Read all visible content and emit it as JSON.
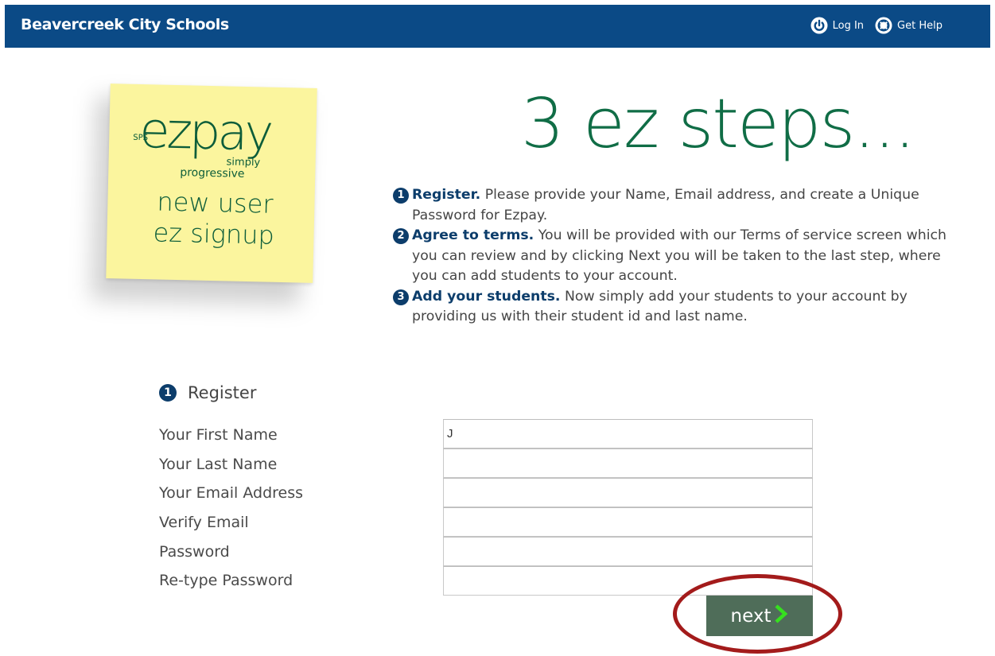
{
  "header": {
    "brand": "Beavercreek City Schools",
    "login_label": "Log In",
    "help_label": "Get Help"
  },
  "sticky_note": {
    "logo_sps": "SPS",
    "logo_main": "ezpay",
    "logo_simply": "simply",
    "logo_progressive": "progressive",
    "line1": "new user",
    "line2": "ez signup",
    "color": "#fbf59e"
  },
  "headline": "3 ez steps...",
  "steps": [
    {
      "number": "1",
      "title": "Register.",
      "text": " Please provide your Name, Email address, and create a Unique Password for Ezpay."
    },
    {
      "number": "2",
      "title": "Agree to terms.",
      "text": " You will be provided with our Terms of service screen which you can review and by clicking Next you will be taken to the last step, where you can add students to your account."
    },
    {
      "number": "3",
      "title": "Add your students.",
      "text": " Now simply add your students to your account by providing us with their student id and last name."
    }
  ],
  "register": {
    "number": "1",
    "heading": "Register",
    "fields": [
      {
        "label": "Your First Name",
        "value": "J"
      },
      {
        "label": "Your Last Name",
        "value": ""
      },
      {
        "label": "Your Email Address",
        "value": ""
      },
      {
        "label": "Verify Email",
        "value": ""
      },
      {
        "label": "Password",
        "value": ""
      },
      {
        "label": "Re-type Password",
        "value": ""
      }
    ],
    "next_label": "next"
  },
  "colors": {
    "header_bg": "#0b4a86",
    "accent_green": "#106d46",
    "step_number_bg": "#0c3d6b",
    "next_button_bg": "#4f6d59",
    "highlight_ring": "#a31b1b"
  }
}
